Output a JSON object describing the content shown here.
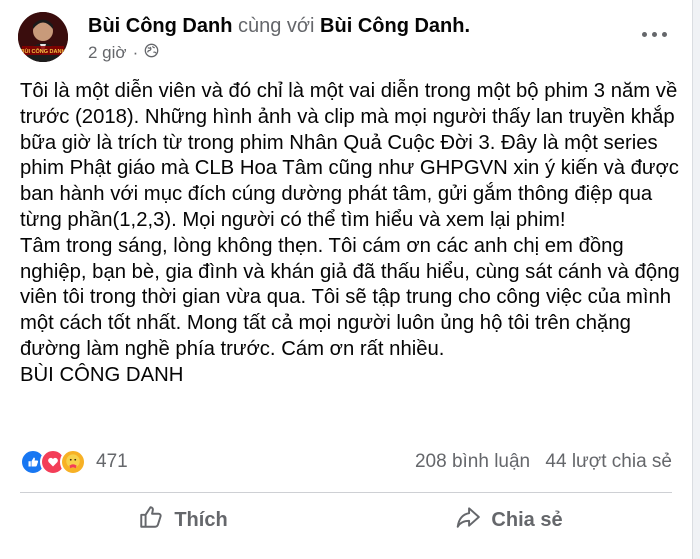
{
  "post": {
    "author": "Bùi Công Danh",
    "with_text": "cùng với",
    "tagged": "Bùi Công Danh.",
    "time": "2 giờ",
    "privacy_icon": "globe-icon",
    "avatar_banner": "BÙI CÔNG DANH",
    "paragraphs": [
      "Tôi là một diễn viên và đó chỉ là một vai diễn trong một bộ phim 3 năm về trước (2018). Những hình ảnh và clip mà mọi người thấy lan truyền khắp bữa giờ là trích từ trong phim Nhân Quả Cuộc Đời 3. Đây là một series phim Phật giáo mà CLB Hoa Tâm cũng như GHPGVN xin ý kiến và được ban hành với mục đích cúng dường phát tâm, gửi gắm thông điệp qua từng phần(1,2,3). Mọi người có thể tìm hiểu và xem lại phim!",
      "Tâm trong sáng, lòng không thẹn. Tôi cám ơn các anh chị em đồng nghiệp, bạn bè, gia đình và khán giả đã thấu hiểu, cùng sát cánh và động viên tôi trong thời gian vừa qua. Tôi sẽ tập trung cho công việc của mình một cách tốt nhất. Mong tất cả mọi người luôn ủng hộ tôi trên chặng đường làm nghề phía trước. Cám ơn rất nhiều.",
      "BÙI CÔNG DANH"
    ]
  },
  "stats": {
    "reaction_icons": [
      "like-icon",
      "love-icon",
      "care-icon"
    ],
    "reaction_count": "471",
    "comments": "208 bình luận",
    "shares": "44 lượt chia sẻ"
  },
  "actions": {
    "like_label": "Thích",
    "share_label": "Chia sẻ"
  },
  "colors": {
    "like_blue": "#1877f2",
    "love_red": "#f33e58",
    "care_yellow": "#f7b125",
    "muted_text": "#65676b"
  }
}
